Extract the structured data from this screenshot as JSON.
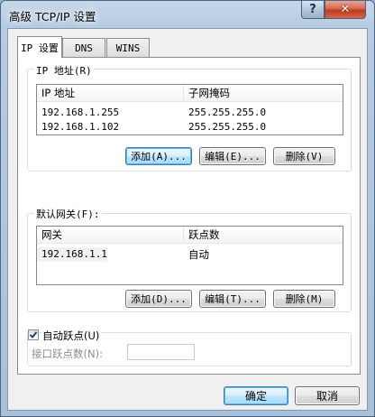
{
  "window": {
    "title": "高级 TCP/IP 设置",
    "help_glyph": "?",
    "close_glyph": "✕"
  },
  "tabs": [
    {
      "label": "IP 设置",
      "active": true
    },
    {
      "label": "DNS",
      "active": false
    },
    {
      "label": "WINS",
      "active": false
    }
  ],
  "ip_group": {
    "label": "IP 地址(R)",
    "columns": [
      "IP 地址",
      "子网掩码"
    ],
    "rows": [
      [
        "192.168.1.255",
        "255.255.255.0"
      ],
      [
        "192.168.1.102",
        "255.255.255.0"
      ]
    ],
    "buttons": {
      "add": "添加(A)...",
      "edit": "编辑(E)...",
      "remove": "删除(V)"
    }
  },
  "gateway_group": {
    "label": "默认网关(F):",
    "columns": [
      "网关",
      "跃点数"
    ],
    "rows": [
      [
        "192.168.1.1",
        "自动"
      ]
    ],
    "buttons": {
      "add": "添加(D)...",
      "edit": "编辑(T)...",
      "remove": "删除(M)"
    }
  },
  "metric": {
    "auto_label": "自动跃点(U)",
    "auto_checked": true,
    "interface_label": "接口跃点数(N):",
    "interface_value": ""
  },
  "footer": {
    "ok": "确定",
    "cancel": "取消"
  },
  "colors": {
    "title_gradient_top": "#c6d8ea",
    "close_red": "#c0381c",
    "default_button_border": "#3c7fb1"
  }
}
